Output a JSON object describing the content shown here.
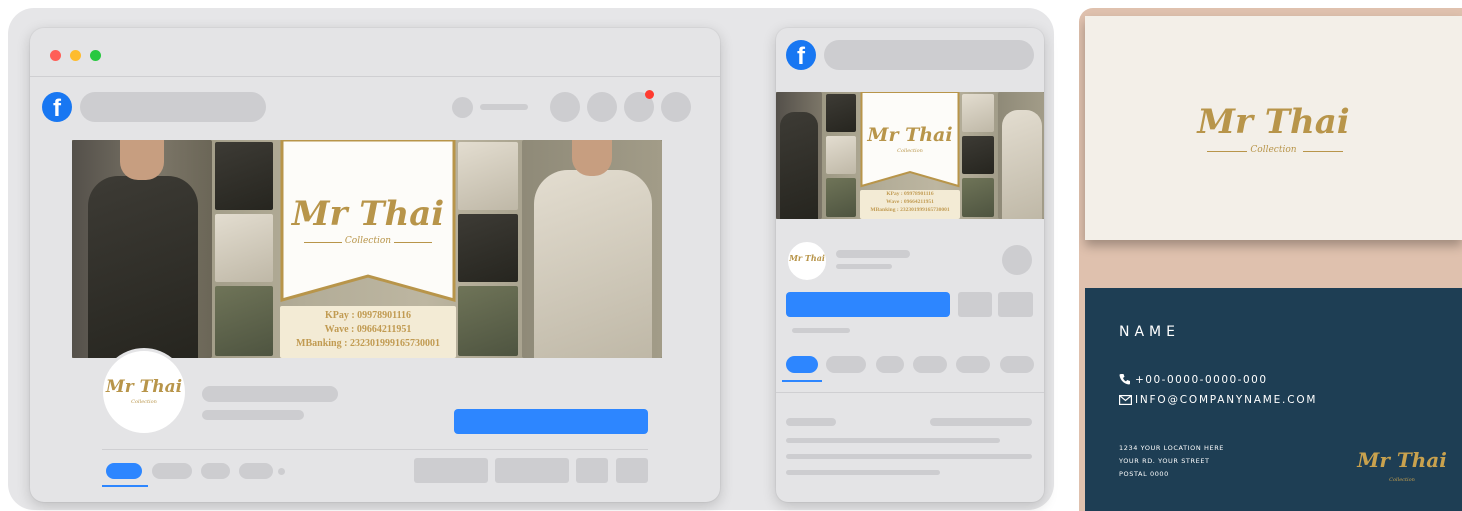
{
  "brand": {
    "name": "Mr Thai",
    "subtitle": "Collection",
    "gold_color": "#b8954a",
    "navy_color": "#1e3e54"
  },
  "cover": {
    "kpay": "KPay : 09978901116",
    "wave": "Wave : 09664211951",
    "mbanking": "MBanking : 232301999165730001"
  },
  "browser": {
    "traffic_lights": [
      "close",
      "minimize",
      "maximize"
    ],
    "logo_glyph": "f",
    "icon": "facebook-icon"
  },
  "phone": {
    "logo_glyph": "f"
  },
  "business_card": {
    "name_label": "NAME",
    "phone": "+00-0000-0000-000",
    "email": "INFO@COMPANYNAME.COM",
    "address_line1": "1234 YOUR LOCATION HERE",
    "address_line2": "YOUR RD. YOUR STREET",
    "address_line3": "POSTAL 0000",
    "phone_icon": "phone-icon",
    "email_icon": "envelope-icon"
  }
}
